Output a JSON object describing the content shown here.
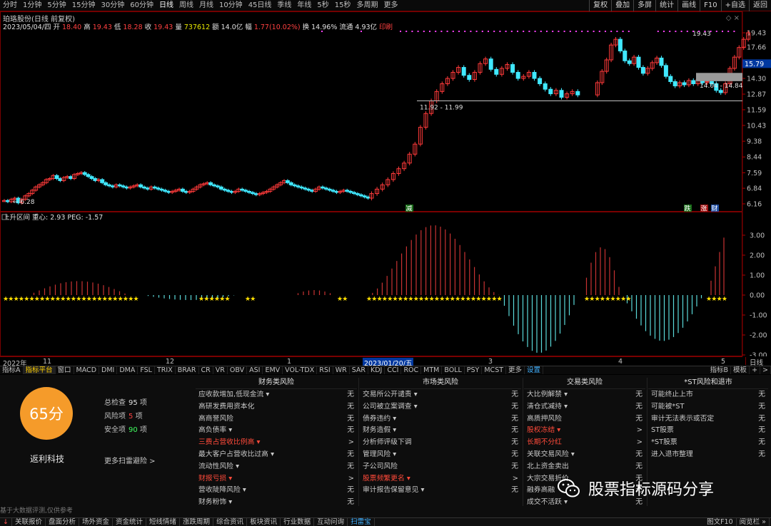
{
  "toolbar": {
    "periods": [
      "分时",
      "1分钟",
      "5分钟",
      "15分钟",
      "30分钟",
      "60分钟",
      "日线",
      "周线",
      "月线",
      "10分钟",
      "45日线",
      "季线",
      "年线",
      "5秒",
      "15秒",
      "多周期",
      "更多"
    ],
    "active_period": "日线",
    "right_buttons": [
      "复权",
      "叠加",
      "多屏",
      "统计",
      "画线",
      "F10",
      "+自选",
      "返回"
    ]
  },
  "stock": {
    "title": "珀珞股份(日线 前复权)",
    "date": "2023/05/04/四",
    "open_label": "开",
    "open": "18.40",
    "high_label": "高",
    "high": "19.43",
    "low_label": "低",
    "low": "18.28",
    "close_label": "收",
    "close": "19.43",
    "volume_label": "量",
    "volume": "737612",
    "amount_label": "额",
    "amount": "14.0亿",
    "change_label": "幅",
    "change": "1.77(10.02%)",
    "turnover_label": "换",
    "turnover": "14.96%",
    "float_label": "流通",
    "float": "4.93亿",
    "print_label": "印刷"
  },
  "price_axis": [
    "19.43",
    "17.66",
    "15.79",
    "14.30",
    "12.87",
    "11.59",
    "10.43",
    "9.38",
    "8.44",
    "7.59",
    "6.84",
    "6.16"
  ],
  "annotations": {
    "high_marker": "19.43",
    "range_low": "11.92 - 11.99",
    "range_box": "14.04 - 14.84",
    "start_marker": "6.28",
    "current_price": "15.79",
    "flag_jian": "减",
    "flag_die": "跌",
    "flag_zhang": "涨",
    "flag_cai": "财"
  },
  "indicator": {
    "title": "上升区间",
    "centroid_label": "重心:",
    "centroid": "2.93",
    "peg_label": "PEG:",
    "peg": "-1.57",
    "axis": [
      "3.00",
      "2.00",
      "1.00",
      "0.00",
      "-1.00",
      "-2.00",
      "-3.00"
    ]
  },
  "xaxis": {
    "labels": [
      "2022年",
      "11",
      "12",
      "1",
      "2023/01/20/五",
      "3",
      "4",
      "5"
    ],
    "corner": "日线"
  },
  "tabs": {
    "items": [
      "指标A",
      "指标平台",
      "窗口",
      "MACD",
      "DMI",
      "DMA",
      "FSL",
      "TRIX",
      "BRAR",
      "CR",
      "VR",
      "OBV",
      "ASI",
      "EMV",
      "VOL-TDX",
      "RSI",
      "WR",
      "SAR",
      "KDJ",
      "CCI",
      "ROC",
      "MTM",
      "BOLL",
      "PSY",
      "MCST",
      "更多",
      "设置"
    ],
    "active": "指标平台",
    "right": [
      "指标B",
      "模板",
      "+",
      ">"
    ]
  },
  "risk": {
    "score": "65分",
    "company": "返利科技",
    "total_label": "总检查",
    "total": "95",
    "total_unit": "项",
    "risk_label": "风险项",
    "risk_count": "5",
    "risk_unit": "项",
    "safe_label": "安全项",
    "safe": "90",
    "safe_unit": "项",
    "more_link": "更多扫雷避险 >",
    "disclaimer": "基于大数据评测,仅供参考",
    "columns": [
      {
        "title": "财务类风险",
        "rows": [
          {
            "label": "应收款增加,低现金流 ▾",
            "result": "无",
            "warn": false
          },
          {
            "label": "高研发费用资本化",
            "result": "无",
            "warn": false
          },
          {
            "label": "高商誉风险",
            "result": "无",
            "warn": false
          },
          {
            "label": "高负债率 ▾",
            "result": "无",
            "warn": false
          },
          {
            "label": "三费占营收比例高 ▾",
            "result": ">",
            "warn": true
          },
          {
            "label": "最大客户占营收比过高 ▾",
            "result": "无",
            "warn": false
          },
          {
            "label": "流动性风险 ▾",
            "result": "无",
            "warn": false
          },
          {
            "label": "财报亏损 ▾",
            "result": ">",
            "warn": true
          },
          {
            "label": "营收陡降风险 ▾",
            "result": "无",
            "warn": false
          },
          {
            "label": "财务粉饰 ▾",
            "result": "无",
            "warn": false
          }
        ]
      },
      {
        "title": "市场类风险",
        "rows": [
          {
            "label": "交易所公开谴责 ▾",
            "result": "无",
            "warn": false
          },
          {
            "label": "公司被立案调查 ▾",
            "result": "无",
            "warn": false
          },
          {
            "label": "债券违约 ▾",
            "result": "无",
            "warn": false
          },
          {
            "label": "财务造假 ▾",
            "result": "无",
            "warn": false
          },
          {
            "label": "分析师评级下调",
            "result": "无",
            "warn": false
          },
          {
            "label": "管理风险 ▾",
            "result": "无",
            "warn": false
          },
          {
            "label": "子公司风险",
            "result": "无",
            "warn": false
          },
          {
            "label": "股票频繁更名 ▾",
            "result": ">",
            "warn": true
          },
          {
            "label": "审计报告保留意见 ▾",
            "result": "无",
            "warn": false
          }
        ]
      },
      {
        "title": "交易类风险",
        "rows": [
          {
            "label": "大比例解禁 ▾",
            "result": "无",
            "warn": false
          },
          {
            "label": "清仓式减持 ▾",
            "result": "无",
            "warn": false
          },
          {
            "label": "高质押风险",
            "result": "无",
            "warn": false
          },
          {
            "label": "股权冻结 ▾",
            "result": ">",
            "warn": true
          },
          {
            "label": "长期不分红",
            "result": ">",
            "warn": true
          },
          {
            "label": "关联交易风险 ▾",
            "result": "无",
            "warn": false
          },
          {
            "label": "北上资金卖出",
            "result": "无",
            "warn": false
          },
          {
            "label": "大宗交易折价",
            "result": "无",
            "warn": false
          },
          {
            "label": "融券高融",
            "result": "无",
            "warn": false
          },
          {
            "label": "成交不活跃 ▾",
            "result": "无",
            "warn": false
          }
        ]
      },
      {
        "title": "*ST风险和退市",
        "rows": [
          {
            "label": "可能终止上市",
            "result": "无",
            "warn": false
          },
          {
            "label": "可能被*ST",
            "result": "无",
            "warn": false
          },
          {
            "label": "审计无法表示或否定",
            "result": "无",
            "warn": false
          },
          {
            "label": "ST股票",
            "result": "无",
            "warn": false
          },
          {
            "label": "*ST股票",
            "result": "无",
            "warn": false
          },
          {
            "label": "进入退市整理",
            "result": "无",
            "warn": false
          }
        ]
      }
    ]
  },
  "statusbar": {
    "items": [
      "↓",
      "关联报价",
      "盘面分析",
      "场外资金",
      "资金统计",
      "短线情绪",
      "涨跌周期",
      "综合资讯",
      "板块资讯",
      "行业数据",
      "互动问询",
      "扫雷宝"
    ],
    "active": "扫雷宝",
    "right": [
      "图文F10",
      "阅览栏 »"
    ]
  },
  "watermark": {
    "text": "股票指标源码分享"
  },
  "colors": {
    "up": "#ff3a3a",
    "down": "#40e8ff",
    "background": "#000000",
    "score": "#f59b2a",
    "star": "#ffe000",
    "purple_dots": "#ff40ff"
  }
}
